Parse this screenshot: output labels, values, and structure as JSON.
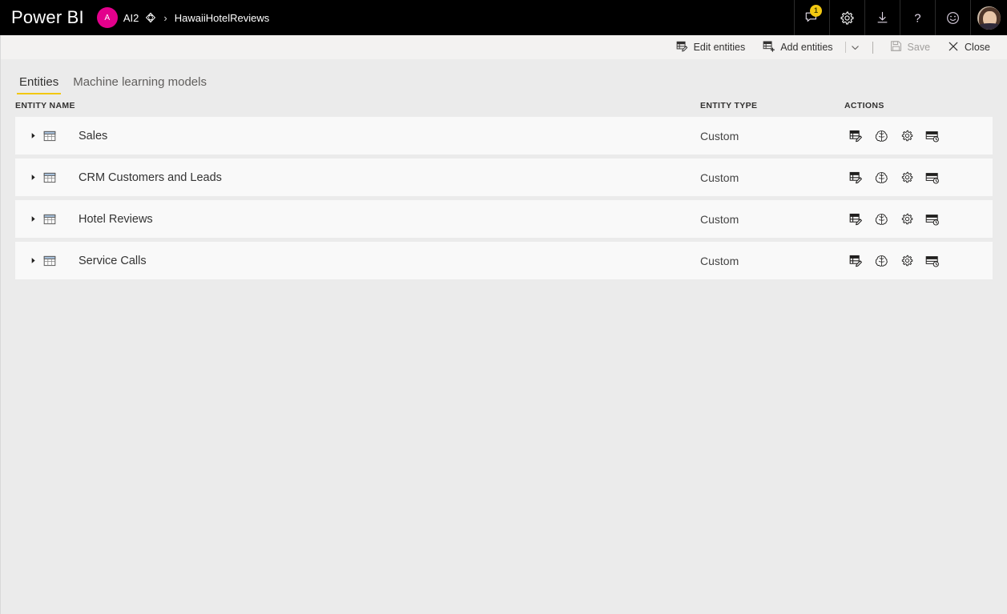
{
  "topbar": {
    "brand": "Power BI",
    "workspace_initial": "A",
    "workspace_name": "AI2",
    "premium_icon": "diamond-icon",
    "separator": "›",
    "dataflow_name": "HawaiiHotelReviews",
    "notification_count": "1",
    "icons": [
      {
        "name": "notifications-icon",
        "label": "Notifications"
      },
      {
        "name": "settings-gear-icon",
        "label": "Settings"
      },
      {
        "name": "download-icon",
        "label": "Download"
      },
      {
        "name": "help-question-icon",
        "label": "Help"
      },
      {
        "name": "feedback-smiley-icon",
        "label": "Feedback"
      },
      {
        "name": "user-avatar",
        "label": "Account manager"
      }
    ]
  },
  "commandbar": {
    "edit_entities": "Edit entities",
    "add_entities": "Add entities",
    "save": "Save",
    "close": "Close",
    "caret": "∨"
  },
  "tabs": [
    {
      "label": "Entities",
      "active": true
    },
    {
      "label": "Machine learning models",
      "active": false
    }
  ],
  "columns": {
    "entity_name": "ENTITY NAME",
    "entity_type": "ENTITY TYPE",
    "actions": "ACTIONS"
  },
  "entities": [
    {
      "name": "Sales",
      "type": "Custom"
    },
    {
      "name": "CRM Customers and Leads",
      "type": "Custom"
    },
    {
      "name": "Hotel Reviews",
      "type": "Custom"
    },
    {
      "name": "Service Calls",
      "type": "Custom"
    }
  ],
  "row_actions": [
    {
      "name": "edit-entity-icon",
      "label": "Edit entity"
    },
    {
      "name": "apply-ml-model-icon",
      "label": "Apply ML model"
    },
    {
      "name": "entity-settings-gear-icon",
      "label": "Settings"
    },
    {
      "name": "incremental-refresh-icon",
      "label": "Incremental refresh"
    }
  ],
  "colors": {
    "topbar_background": "#000000",
    "workspace_avatar": "#e3008c",
    "accent_yellow": "#f2c811",
    "page_background": "#ebebeb",
    "row_background": "#f9f9f9",
    "commandbar_background": "#f3f2f1"
  }
}
